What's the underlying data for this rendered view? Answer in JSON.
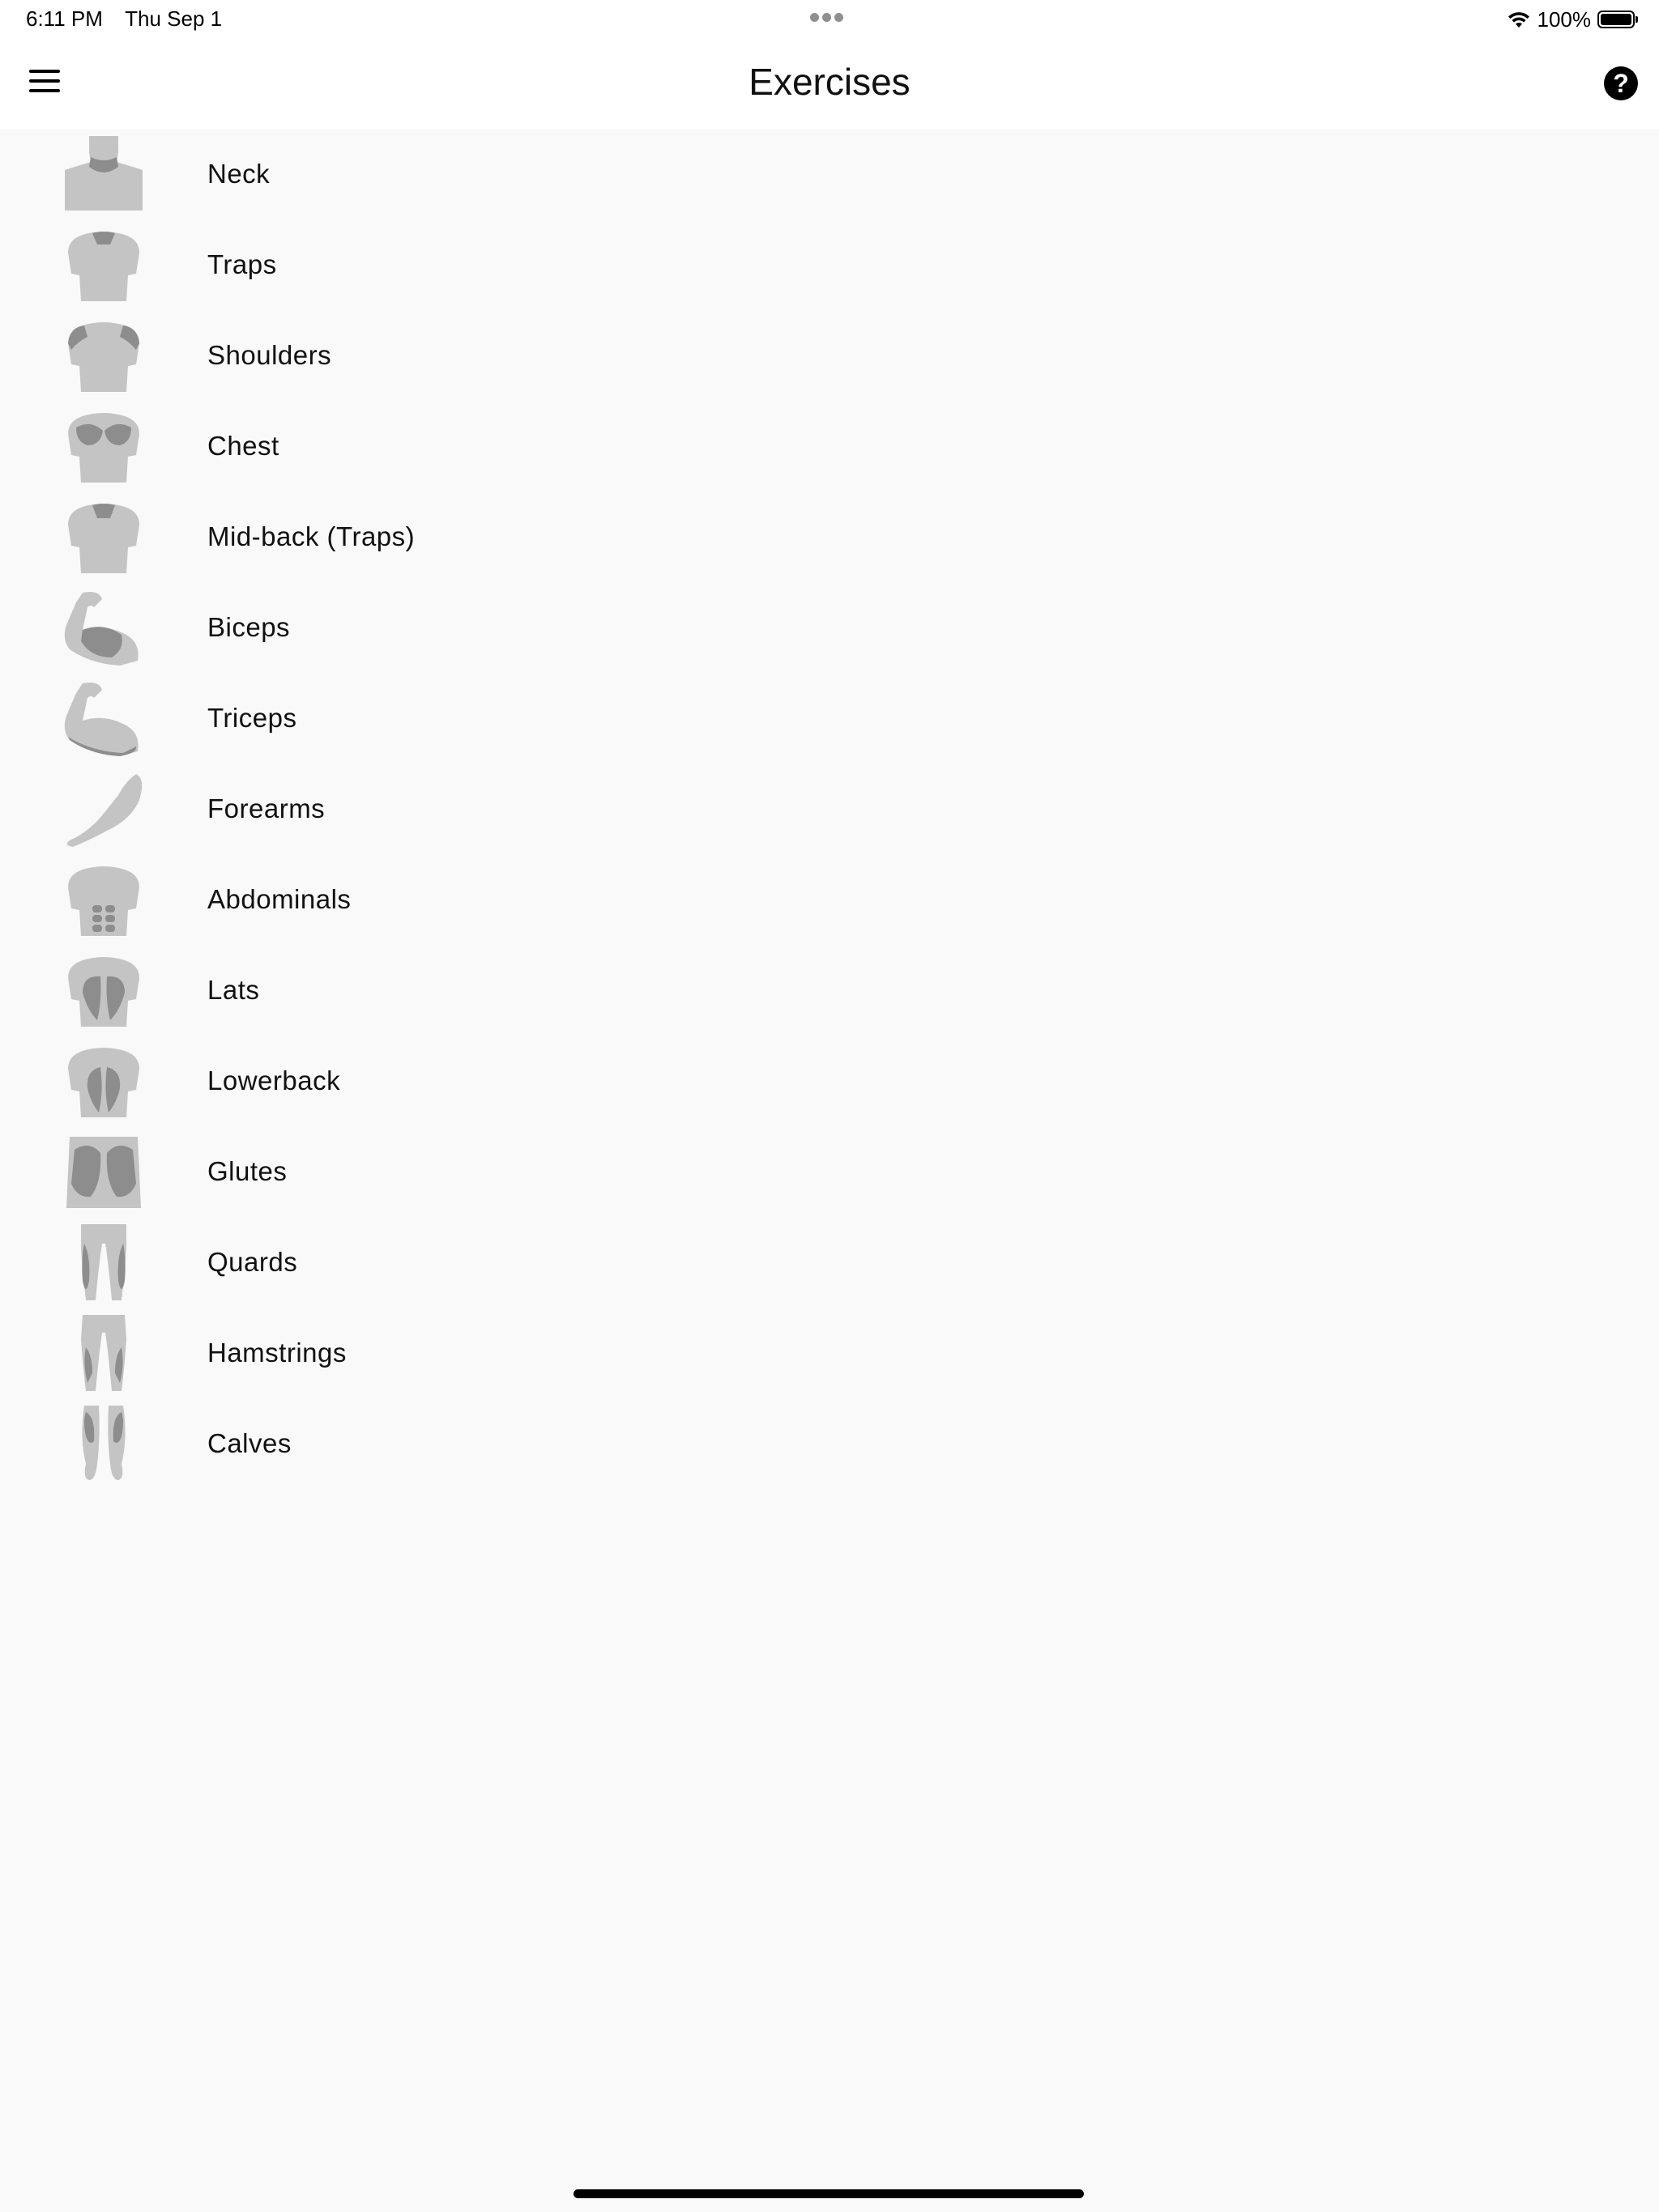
{
  "status_bar": {
    "time": "6:11 PM",
    "date": "Thu Sep 1",
    "battery_percent": "100%",
    "battery_level": 1.0
  },
  "header": {
    "title": "Exercises",
    "menu_icon": "hamburger-menu-icon",
    "help_icon": "question-mark-icon",
    "help_glyph": "?"
  },
  "muscle_groups": [
    {
      "label": "Neck",
      "icon": "neck-icon"
    },
    {
      "label": "Traps",
      "icon": "traps-icon"
    },
    {
      "label": "Shoulders",
      "icon": "shoulders-icon"
    },
    {
      "label": "Chest",
      "icon": "chest-icon"
    },
    {
      "label": "Mid-back (Traps)",
      "icon": "mid-back-icon"
    },
    {
      "label": "Biceps",
      "icon": "biceps-icon"
    },
    {
      "label": "Triceps",
      "icon": "triceps-icon"
    },
    {
      "label": "Forearms",
      "icon": "forearms-icon"
    },
    {
      "label": "Abdominals",
      "icon": "abdominals-icon"
    },
    {
      "label": "Lats",
      "icon": "lats-icon"
    },
    {
      "label": "Lowerback",
      "icon": "lowerback-icon"
    },
    {
      "label": "Glutes",
      "icon": "glutes-icon"
    },
    {
      "label": "Quards",
      "icon": "quads-icon"
    },
    {
      "label": "Hamstrings",
      "icon": "hamstrings-icon"
    },
    {
      "label": "Calves",
      "icon": "calves-icon"
    }
  ],
  "colors": {
    "background": "#f9f9f9",
    "bar_background": "#ffffff",
    "body_light": "#c4c4c4",
    "muscle_dark": "#8d8d8d"
  }
}
